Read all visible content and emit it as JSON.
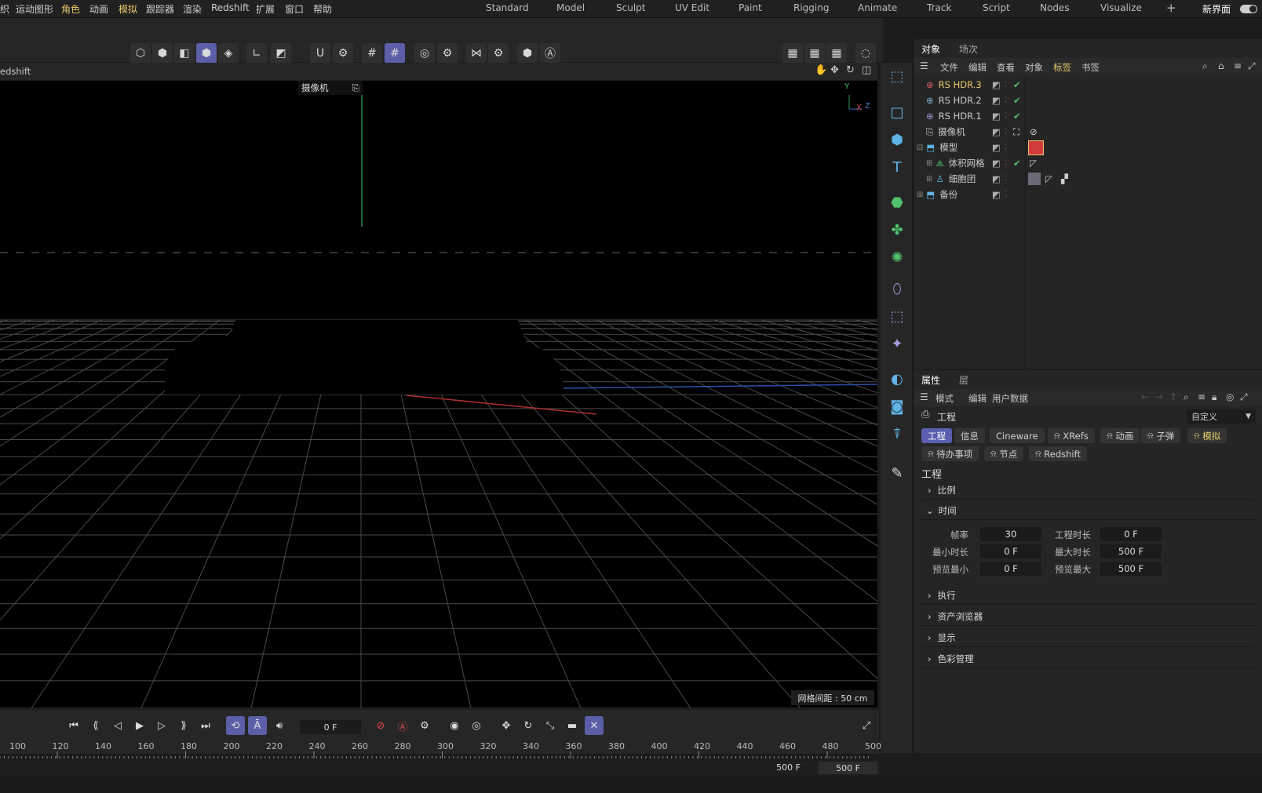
{
  "menu": [
    "织",
    "运动图形",
    "角色",
    "动画",
    "模拟",
    "跟踪器",
    "渲染",
    "Redshift",
    "扩展",
    "窗口",
    "帮助"
  ],
  "menu_highlight": [
    "角色",
    "模拟"
  ],
  "layouts": [
    "Standard",
    "Model",
    "Sculpt",
    "UV Edit",
    "Paint",
    "Rigging",
    "Animate",
    "Track",
    "Script",
    "Nodes",
    "Visualize"
  ],
  "layout_add": "+",
  "new_ui_label": "新界面",
  "viewport": {
    "title": "edshift",
    "camera_label": "摄像机",
    "axis_y": "Y",
    "axis_x": "X",
    "axis_z": "Z",
    "grid_spacing": "网格间距 : 50 cm"
  },
  "objmgr": {
    "tabs": [
      "对象",
      "场次"
    ],
    "menu": [
      "文件",
      "编辑",
      "查看",
      "对象",
      "标签",
      "书签"
    ],
    "menu_highlight": "标签",
    "objects": [
      {
        "name": "RS HDR.3",
        "highlight": true
      },
      {
        "name": "RS HDR.2",
        "highlight": false
      },
      {
        "name": "RS HDR.1",
        "highlight": false
      },
      {
        "name": "摄像机",
        "highlight": false
      },
      {
        "name": "模型",
        "highlight": false
      },
      {
        "name": "体积网格",
        "highlight": false
      },
      {
        "name": "细胞团",
        "highlight": false
      },
      {
        "name": "备份",
        "highlight": false
      }
    ]
  },
  "attr": {
    "tabs": [
      "属性",
      "层"
    ],
    "menu": [
      "模式",
      "编辑",
      "用户数据"
    ],
    "object_name": "工程",
    "preset": "自定义",
    "pills_row1": [
      "工程",
      "信息",
      "Cineware",
      "XRefs",
      "动画",
      "子弹",
      "模拟"
    ],
    "pills_row2": [
      "待办事项",
      "节点",
      "Redshift"
    ],
    "section_title": "工程",
    "sections_top": [
      "比例",
      "时间"
    ],
    "fields": [
      {
        "label": "帧率",
        "value": "30",
        "label2": "工程时长",
        "value2": "0 F"
      },
      {
        "label": "最小时长",
        "value": "0 F",
        "label2": "最大时长",
        "value2": "500 F"
      },
      {
        "label": "预览最小",
        "value": "0 F",
        "label2": "预览最大",
        "value2": "500 F"
      }
    ],
    "sections_bottom": [
      "执行",
      "资产浏览器",
      "显示",
      "色彩管理"
    ]
  },
  "timeline": {
    "current_frame": "0 F",
    "ruler": [
      "100",
      "120",
      "140",
      "160",
      "180",
      "200",
      "220",
      "240",
      "260",
      "280",
      "300",
      "320",
      "340",
      "360",
      "380",
      "400",
      "420",
      "440",
      "460",
      "480",
      "500"
    ],
    "end_a": "500 F",
    "end_b": "500 F"
  },
  "colors": {
    "accent": "#5b5fa8",
    "highlight_text": "#e8c86a",
    "check": "#4fc36a",
    "icon_blue": "#5fb4e6"
  }
}
